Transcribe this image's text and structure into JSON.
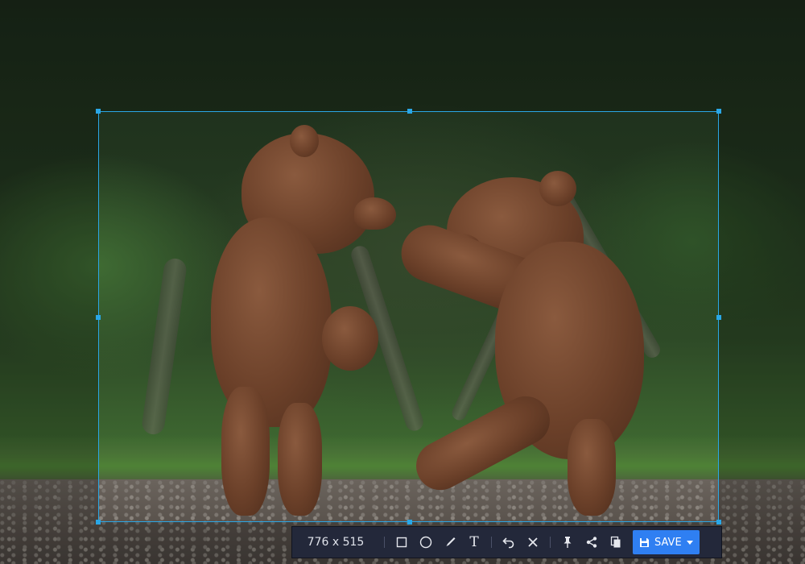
{
  "selection": {
    "size_label": "776 x 515"
  },
  "toolbar": {
    "tools": [
      {
        "name": "rectangle-tool",
        "icon": "rectangle-icon"
      },
      {
        "name": "ellipse-tool",
        "icon": "ellipse-icon"
      },
      {
        "name": "pen-tool",
        "icon": "pen-icon"
      },
      {
        "name": "text-tool",
        "icon": "text-icon"
      },
      {
        "name": "undo-tool",
        "icon": "undo-icon"
      },
      {
        "name": "close-tool",
        "icon": "close-icon"
      },
      {
        "name": "pin-tool",
        "icon": "pin-icon"
      },
      {
        "name": "share-tool",
        "icon": "share-icon"
      },
      {
        "name": "copy-tool",
        "icon": "copy-icon"
      }
    ],
    "text_tool_glyph": "T",
    "save_label": "SAVE",
    "save_icon": "floppy-disk-icon"
  },
  "colors": {
    "accent": "#2aa7e6",
    "toolbar_bg": "#23283a",
    "save_bg": "#2f7ff2"
  }
}
